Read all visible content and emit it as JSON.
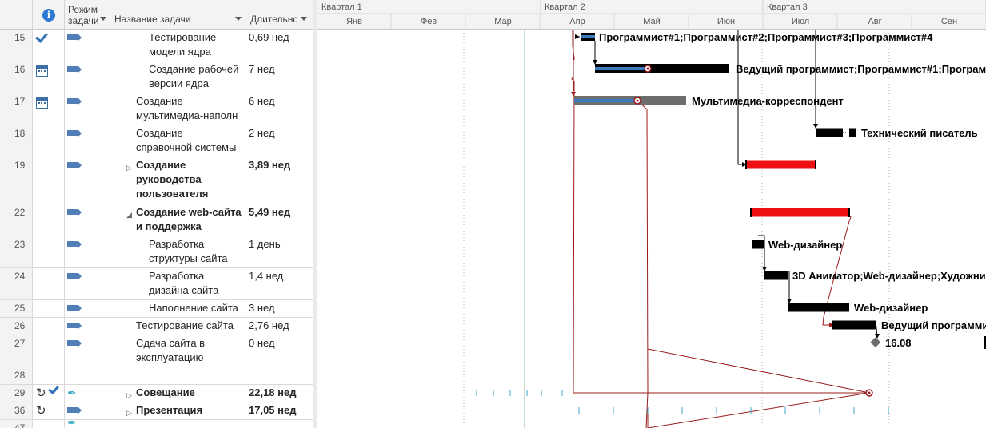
{
  "header": {
    "mode_line1": "Режим",
    "mode_line2": "задачи",
    "name": "Название задачи",
    "duration": "Длительнс",
    "info_glyph": "i"
  },
  "timescale": {
    "quarters": [
      "Квартал 1",
      "Квартал 2",
      "Квартал 3"
    ],
    "months": [
      "Янв",
      "Фев",
      "Мар",
      "Апр",
      "Май",
      "Июн",
      "Июл",
      "Авг",
      "Сен"
    ]
  },
  "rows": [
    {
      "id": "15",
      "indicator": "check",
      "mode": "auto",
      "name_lines": [
        "Тестирование",
        "модели ядра"
      ],
      "duration": "0,69 нед",
      "level": 2,
      "summary": false
    },
    {
      "id": "16",
      "indicator": "calendar",
      "mode": "auto",
      "name_lines": [
        "Создание рабочей",
        "версии ядра"
      ],
      "duration": "7 нед",
      "level": 2,
      "summary": false
    },
    {
      "id": "17",
      "indicator": "calendar",
      "mode": "auto",
      "name_lines": [
        "Создание",
        "мультимедиа-наполн"
      ],
      "duration": "6 нед",
      "level": 1,
      "summary": false
    },
    {
      "id": "18",
      "indicator": "",
      "mode": "auto",
      "name_lines": [
        "Создание",
        "справочной системы"
      ],
      "duration": "2 нед",
      "level": 1,
      "summary": false
    },
    {
      "id": "19",
      "indicator": "",
      "mode": "auto",
      "name_lines": [
        "Создание",
        "руководства",
        "пользователя"
      ],
      "duration": "3,89 нед",
      "level": 1,
      "summary": true,
      "expand": "collapsed"
    },
    {
      "id": "22",
      "indicator": "",
      "mode": "auto",
      "name_lines": [
        "Создание web-сайта",
        "и поддержка"
      ],
      "duration": "5,49 нед",
      "level": 1,
      "summary": true,
      "expand": "expanded"
    },
    {
      "id": "23",
      "indicator": "",
      "mode": "auto",
      "name_lines": [
        "Разработка",
        "структуры сайта"
      ],
      "duration": "1 день",
      "level": 2,
      "summary": false
    },
    {
      "id": "24",
      "indicator": "",
      "mode": "auto",
      "name_lines": [
        "Разработка",
        "дизайна сайта"
      ],
      "duration": "1,4 нед",
      "level": 2,
      "summary": false
    },
    {
      "id": "25",
      "indicator": "",
      "mode": "auto",
      "name_lines": [
        "Наполнение сайта"
      ],
      "duration": "3 нед",
      "level": 2,
      "summary": false
    },
    {
      "id": "26",
      "indicator": "",
      "mode": "auto",
      "name_lines": [
        "Тестирование сайта"
      ],
      "duration": "2,76 нед",
      "level": 1,
      "summary": false
    },
    {
      "id": "27",
      "indicator": "",
      "mode": "auto",
      "name_lines": [
        "Сдача сайта в",
        "эксплуатацию"
      ],
      "duration": "0 нед",
      "level": 1,
      "summary": false
    },
    {
      "id": "28",
      "indicator": "",
      "mode": "",
      "name_lines": [
        ""
      ],
      "duration": "",
      "level": 1,
      "summary": false
    },
    {
      "id": "29",
      "indicator": "recurring-check",
      "mode": "manual",
      "name_lines": [
        "Совещание"
      ],
      "duration": "22,18 нед",
      "level": 1,
      "summary": true,
      "expand": "collapsed"
    },
    {
      "id": "36",
      "indicator": "recurring",
      "mode": "auto",
      "name_lines": [
        "Презентация"
      ],
      "duration": "17,05 нед",
      "level": 1,
      "summary": true,
      "expand": "collapsed"
    },
    {
      "id": "47",
      "indicator": "",
      "mode": "manual",
      "name_lines": [
        ""
      ],
      "duration": "",
      "level": 1,
      "summary": false
    }
  ],
  "bar_labels": {
    "r15": "Программист#1;Программист#2;Программист#3;Программист#4",
    "r16": "Ведущий программист;Программист#1;Программ",
    "r17": "Мультимедиа-корреспондент",
    "r18": "Технический писатель",
    "r23": "Web-дизайнер",
    "r24": "3D Аниматор;Web-дизайнер;Художни",
    "r25": "Web-дизайнер",
    "r26": "Ведущий программи",
    "r27": "16.08"
  },
  "colors": {
    "task_bar": "#000000",
    "progress": "#3b78c4",
    "critical_summary": "#ee1111",
    "link": "#9b1c1c",
    "grey_bar": "#6d6d6d",
    "milestone": "#6d6d6d",
    "today_line": "#8fbf8f",
    "recurring_tick": "#3aa6c8"
  }
}
